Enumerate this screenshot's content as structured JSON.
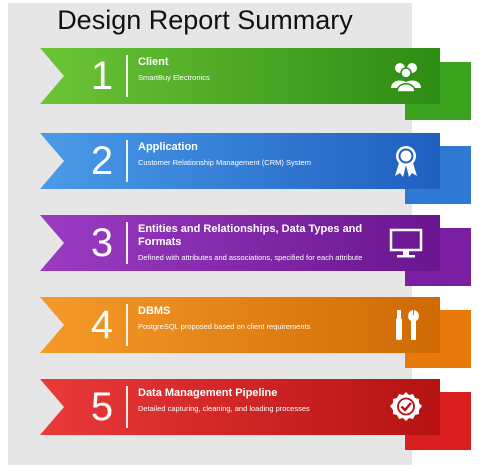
{
  "title": "Design Report Summary",
  "items": [
    {
      "number": "1",
      "heading": "Client",
      "description": "SmartBuy Electronics",
      "icon": "users-icon",
      "color": "#3aa21c",
      "shadow": "#2a7a10"
    },
    {
      "number": "2",
      "heading": "Application",
      "description": "Customer Relationship Management (CRM) System",
      "icon": "award-ribbon-icon",
      "color": "#2f78d4",
      "shadow": "#1f58a8"
    },
    {
      "number": "3",
      "heading": "Entities and Relationships, Data Types and Formats",
      "description": "Defined with attributes and associations, specified for each attribute",
      "icon": "monitor-icon",
      "color": "#7b1fa2",
      "shadow": "#5a1480"
    },
    {
      "number": "4",
      "heading": "DBMS",
      "description": "PostgreSQL proposed based on client requirements",
      "icon": "tools-icon",
      "color": "#e87a0b",
      "shadow": "#b95c06"
    },
    {
      "number": "5",
      "heading": "Data Management Pipeline",
      "description": "Detailed capturing, cleaning, and loading processes",
      "icon": "check-badge-icon",
      "color": "#d81e1e",
      "shadow": "#a81414"
    }
  ]
}
